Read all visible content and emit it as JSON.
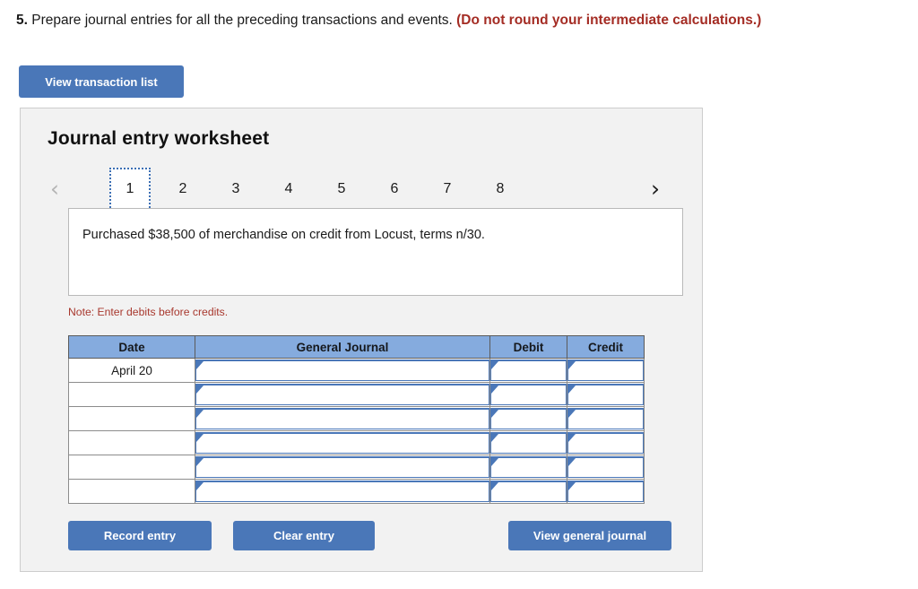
{
  "question": {
    "number": "5.",
    "text": " Prepare journal entries for all the preceding transactions and events. ",
    "emphasis": "(Do not round your intermediate calculations.)"
  },
  "toolbar": {
    "view_transaction_list_label": "View transaction list"
  },
  "worksheet": {
    "title": "Journal entry worksheet",
    "pager": {
      "prev_icon": "‹",
      "next_icon": "›",
      "tabs": [
        {
          "label": "1",
          "active": true
        },
        {
          "label": "2",
          "active": false
        },
        {
          "label": "3",
          "active": false
        },
        {
          "label": "4",
          "active": false
        },
        {
          "label": "5",
          "active": false
        },
        {
          "label": "6",
          "active": false
        },
        {
          "label": "7",
          "active": false
        },
        {
          "label": "8",
          "active": false
        }
      ]
    },
    "transaction_text": "Purchased $38,500 of merchandise on credit from Locust, terms n/30.",
    "note": "Note: Enter debits before credits.",
    "table": {
      "headers": [
        "Date",
        "General Journal",
        "Debit",
        "Credit"
      ],
      "rows": [
        {
          "date": "April 20",
          "general_journal": "",
          "debit": "",
          "credit": ""
        },
        {
          "date": "",
          "general_journal": "",
          "debit": "",
          "credit": ""
        },
        {
          "date": "",
          "general_journal": "",
          "debit": "",
          "credit": ""
        },
        {
          "date": "",
          "general_journal": "",
          "debit": "",
          "credit": ""
        },
        {
          "date": "",
          "general_journal": "",
          "debit": "",
          "credit": ""
        },
        {
          "date": "",
          "general_journal": "",
          "debit": "",
          "credit": ""
        }
      ]
    },
    "actions": {
      "record_entry_label": "Record entry",
      "clear_entry_label": "Clear entry",
      "view_general_journal_label": "View general journal"
    }
  },
  "colors": {
    "button_blue": "#4a77b8",
    "header_blue": "#85abde",
    "panel_gray": "#f2f2f2",
    "note_red": "#a8382e",
    "emphasis_red": "#a42c24"
  }
}
